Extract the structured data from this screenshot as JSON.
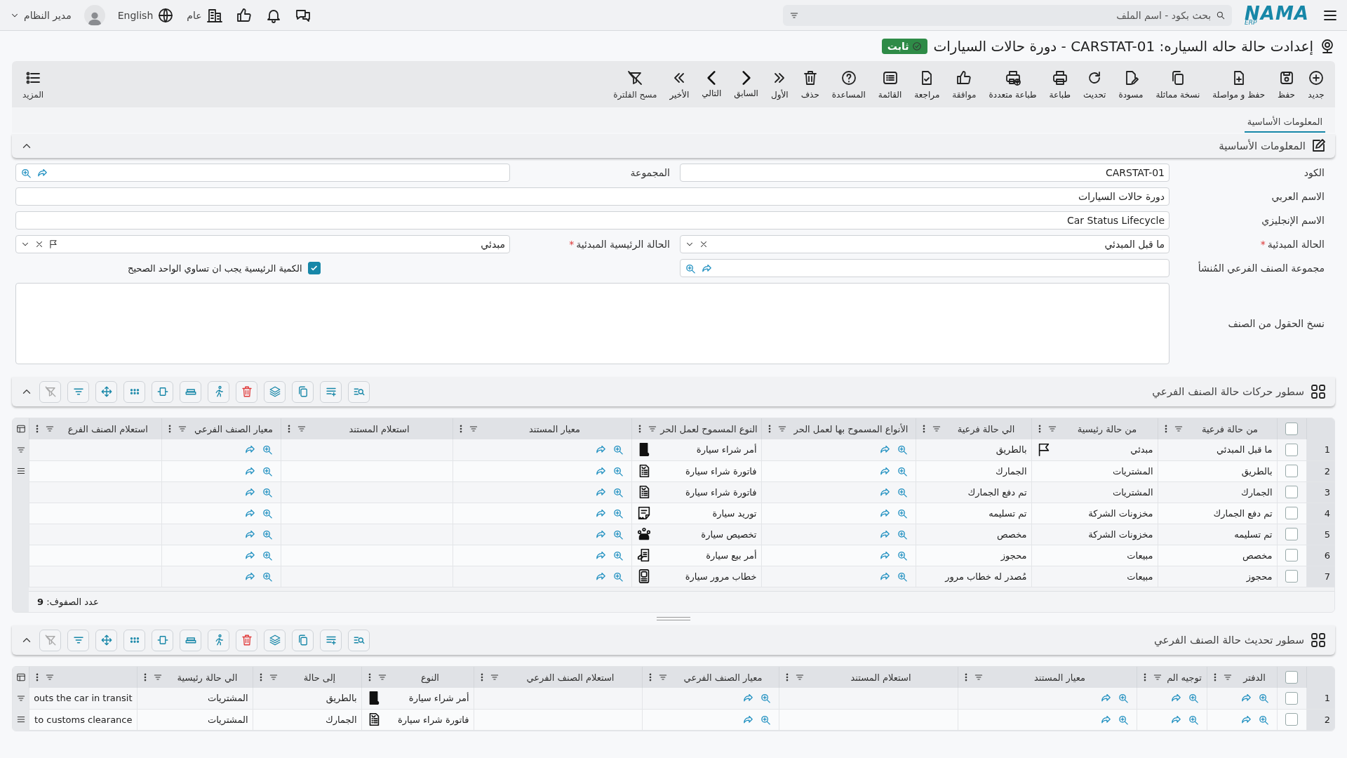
{
  "topbar": {
    "logo": {
      "text": "NAMA",
      "sub": "ERP"
    },
    "search": {
      "placeholder": "بحث بكود - اسم الملف"
    },
    "user": {
      "name": "مدير النظام"
    },
    "language": "English",
    "branch": "عام"
  },
  "page": {
    "title": "إعدادت حالة حاله السياره: CARSTAT-01 - دورة حالات السيارات",
    "status": {
      "label": "ثابت"
    }
  },
  "toolbar": [
    {
      "label": "جديد",
      "kind": "new",
      "disabled": false
    },
    {
      "label": "حفظ",
      "kind": "save",
      "disabled": false
    },
    {
      "label": "حفظ و مواصلة",
      "kind": "save_continue",
      "disabled": false
    },
    {
      "label": "نسخة مماثلة",
      "kind": "duplicate",
      "disabled": false
    },
    {
      "label": "مسودة",
      "kind": "draft",
      "disabled": false
    },
    {
      "label": "تحديث",
      "kind": "refresh",
      "disabled": false
    },
    {
      "label": "طباعة",
      "kind": "print",
      "disabled": false
    },
    {
      "label": "طباعة متعددة",
      "kind": "print_multi",
      "disabled": false
    },
    {
      "label": "موافقة",
      "kind": "approve",
      "disabled": true
    },
    {
      "label": "مراجعة",
      "kind": "review",
      "disabled": false
    },
    {
      "label": "القائمة",
      "kind": "list",
      "disabled": false
    },
    {
      "label": "المساعدة",
      "kind": "help",
      "disabled": false
    },
    {
      "label": "حذف",
      "kind": "delete",
      "disabled": false
    },
    {
      "label": "الأول",
      "kind": "first",
      "disabled": false
    },
    {
      "label": "السابق",
      "kind": "prev",
      "disabled": false
    },
    {
      "label": "التالي",
      "kind": "next",
      "disabled": false
    },
    {
      "label": "الأخير",
      "kind": "last",
      "disabled": false
    },
    {
      "label": "مسح الفلترة",
      "kind": "clear_filter",
      "disabled": true
    }
  ],
  "more": {
    "label": "المزيد"
  },
  "tabs": [
    {
      "label": "المعلومات الأساسية",
      "selected": true
    }
  ],
  "section": {
    "title": "المعلومات الأساسية"
  },
  "form": {
    "code": {
      "label": "الكود",
      "value": "CARSTAT-01"
    },
    "group": {
      "label": "المجموعة"
    },
    "arabic_name": {
      "label": "الاسم العربي",
      "value": "دورة حالات السيارات"
    },
    "english_name": {
      "label": "الاسم الإنجليزي",
      "value": "Car Status Lifecycle"
    },
    "initial_status": {
      "label": "الحالة المبدئية",
      "required_mark": "*",
      "value": "ما قبل المبدئي"
    },
    "initial_main_status": {
      "label": "الحالة الرئيسية المبدئية",
      "required_mark": "*",
      "value": "مبدئي"
    },
    "sub_item_group": {
      "label": "مجموعة الصنف الفرعي المُنشأ"
    },
    "integer_qty": {
      "label": "الكمية الرئيسية يجب ان تساوي الواحد الصحيح",
      "checked": true
    },
    "copy_fields": {
      "label": "نسخ الحقول من الصنف"
    }
  },
  "grids": [
    {
      "title": "سطور حركات حالة الصنف الفرعي",
      "all_checked": false,
      "tools": [
        {
          "kind": "clear_filter",
          "disabled": true
        },
        {
          "kind": "filter",
          "disabled": false
        },
        {
          "kind": "move",
          "disabled": false
        },
        {
          "kind": "dots",
          "disabled": false
        },
        {
          "kind": "fit",
          "disabled": false
        },
        {
          "kind": "rows",
          "disabled": false
        },
        {
          "kind": "run",
          "disabled": false
        },
        {
          "kind": "trash",
          "disabled": false
        },
        {
          "kind": "layers",
          "disabled": false
        },
        {
          "kind": "copy",
          "disabled": false
        },
        {
          "kind": "add_lines",
          "disabled": false
        },
        {
          "kind": "search_list",
          "disabled": false
        }
      ],
      "columns": [
        {
          "label": "من حالة فرعية",
          "kind": "text"
        },
        {
          "label": "من حالة رئيسية",
          "kind": "status"
        },
        {
          "label": "الي حالة فرعية",
          "kind": "text"
        },
        {
          "label": "الأنواع المسموح بها لعمل الحر",
          "kind": "links"
        },
        {
          "label": "النوع المسموح لعمل الحر",
          "kind": "doc"
        },
        {
          "label": "معيار المستند",
          "kind": "links"
        },
        {
          "label": "استعلام المستند",
          "kind": "blank"
        },
        {
          "label": "معيار الصنف الفرعي",
          "kind": "links"
        },
        {
          "label": "استعلام الصنف الفرع",
          "kind": "blank"
        }
      ],
      "rows": [
        {
          "num": "1",
          "checked": false,
          "flagged": true,
          "values": [
            "ما قبل المبدئي",
            "مبدئي",
            "بالطريق"
          ],
          "doc": {
            "text": "أمر شراء سيارة",
            "kind": "order"
          }
        },
        {
          "num": "2",
          "checked": false,
          "flagged": false,
          "values": [
            "بالطريق",
            "المشتريات",
            "الجمارك"
          ],
          "doc": {
            "text": "فاتورة شراء سيارة",
            "kind": "invoice"
          }
        },
        {
          "num": "3",
          "checked": false,
          "flagged": false,
          "values": [
            "الجمارك",
            "المشتريات",
            "تم دفع الجمارك"
          ],
          "doc": {
            "text": "فاتورة شراء سيارة",
            "kind": "invoice"
          }
        },
        {
          "num": "4",
          "checked": false,
          "flagged": false,
          "values": [
            "تم دفع الجمارك",
            "مخزونات الشركة",
            "تم تسليمه"
          ],
          "doc": {
            "text": "توريد سيارة",
            "kind": "receipt"
          }
        },
        {
          "num": "5",
          "checked": false,
          "flagged": false,
          "values": [
            "تم تسليمه",
            "مخزونات الشركة",
            "مخصص"
          ],
          "doc": {
            "text": "تخصيص سيارة",
            "kind": "allocation"
          }
        },
        {
          "num": "6",
          "checked": false,
          "flagged": false,
          "values": [
            "مخصص",
            "مبيعات",
            "محجوز"
          ],
          "doc": {
            "text": "أمر بيع سيارة",
            "kind": "sale"
          }
        },
        {
          "num": "7",
          "checked": false,
          "flagged": false,
          "values": [
            "محجوز",
            "مبيعات",
            "مُصدر له خطاب مرور"
          ],
          "doc": {
            "text": "خطاب مرور سيارة",
            "kind": "letter"
          }
        }
      ],
      "footer": "عدد الصفوف: **9**"
    },
    {
      "title": "سطور تحديث حالة الصنف الفرعي",
      "all_checked": false,
      "tools": [
        {
          "kind": "clear_filter",
          "disabled": true
        },
        {
          "kind": "filter",
          "disabled": false
        },
        {
          "kind": "move",
          "disabled": false
        },
        {
          "kind": "dots",
          "disabled": false
        },
        {
          "kind": "fit",
          "disabled": false
        },
        {
          "kind": "rows",
          "disabled": false
        },
        {
          "kind": "run",
          "disabled": false
        },
        {
          "kind": "trash",
          "disabled": false
        },
        {
          "kind": "layers",
          "disabled": false
        },
        {
          "kind": "copy",
          "disabled": false
        },
        {
          "kind": "add_lines",
          "disabled": false
        },
        {
          "kind": "search_list",
          "disabled": false
        }
      ],
      "columns": [
        {
          "label": "الدفتر",
          "kind": "links"
        },
        {
          "label": "توجيه الم",
          "kind": "links"
        },
        {
          "label": "معيار المستند",
          "kind": "links"
        },
        {
          "label": "استعلام المستند",
          "kind": "blank"
        },
        {
          "label": "معيار الصنف الفرعي",
          "kind": "links"
        },
        {
          "label": "استعلام الصنف الفرعي",
          "kind": "blank"
        },
        {
          "label": "النوع",
          "kind": "doc"
        },
        {
          "label": "إلى حالة",
          "kind": "text"
        },
        {
          "label": "الي حالة رئيسية",
          "kind": "text"
        },
        {
          "kind": "text"
        }
      ],
      "rows": [
        {
          "num": "1",
          "checked": false,
          "values": [
            "بالطريق",
            "المشتريات",
            "outs the car in transit"
          ],
          "doc": {
            "text": "أمر شراء سيارة",
            "kind": "order"
          }
        },
        {
          "num": "2",
          "checked": false,
          "values": [
            "الجمارك",
            "المشتريات",
            "to customs clearance"
          ],
          "doc": {
            "text": "فاتورة شراء سيارة",
            "kind": "invoice"
          }
        }
      ]
    }
  ]
}
